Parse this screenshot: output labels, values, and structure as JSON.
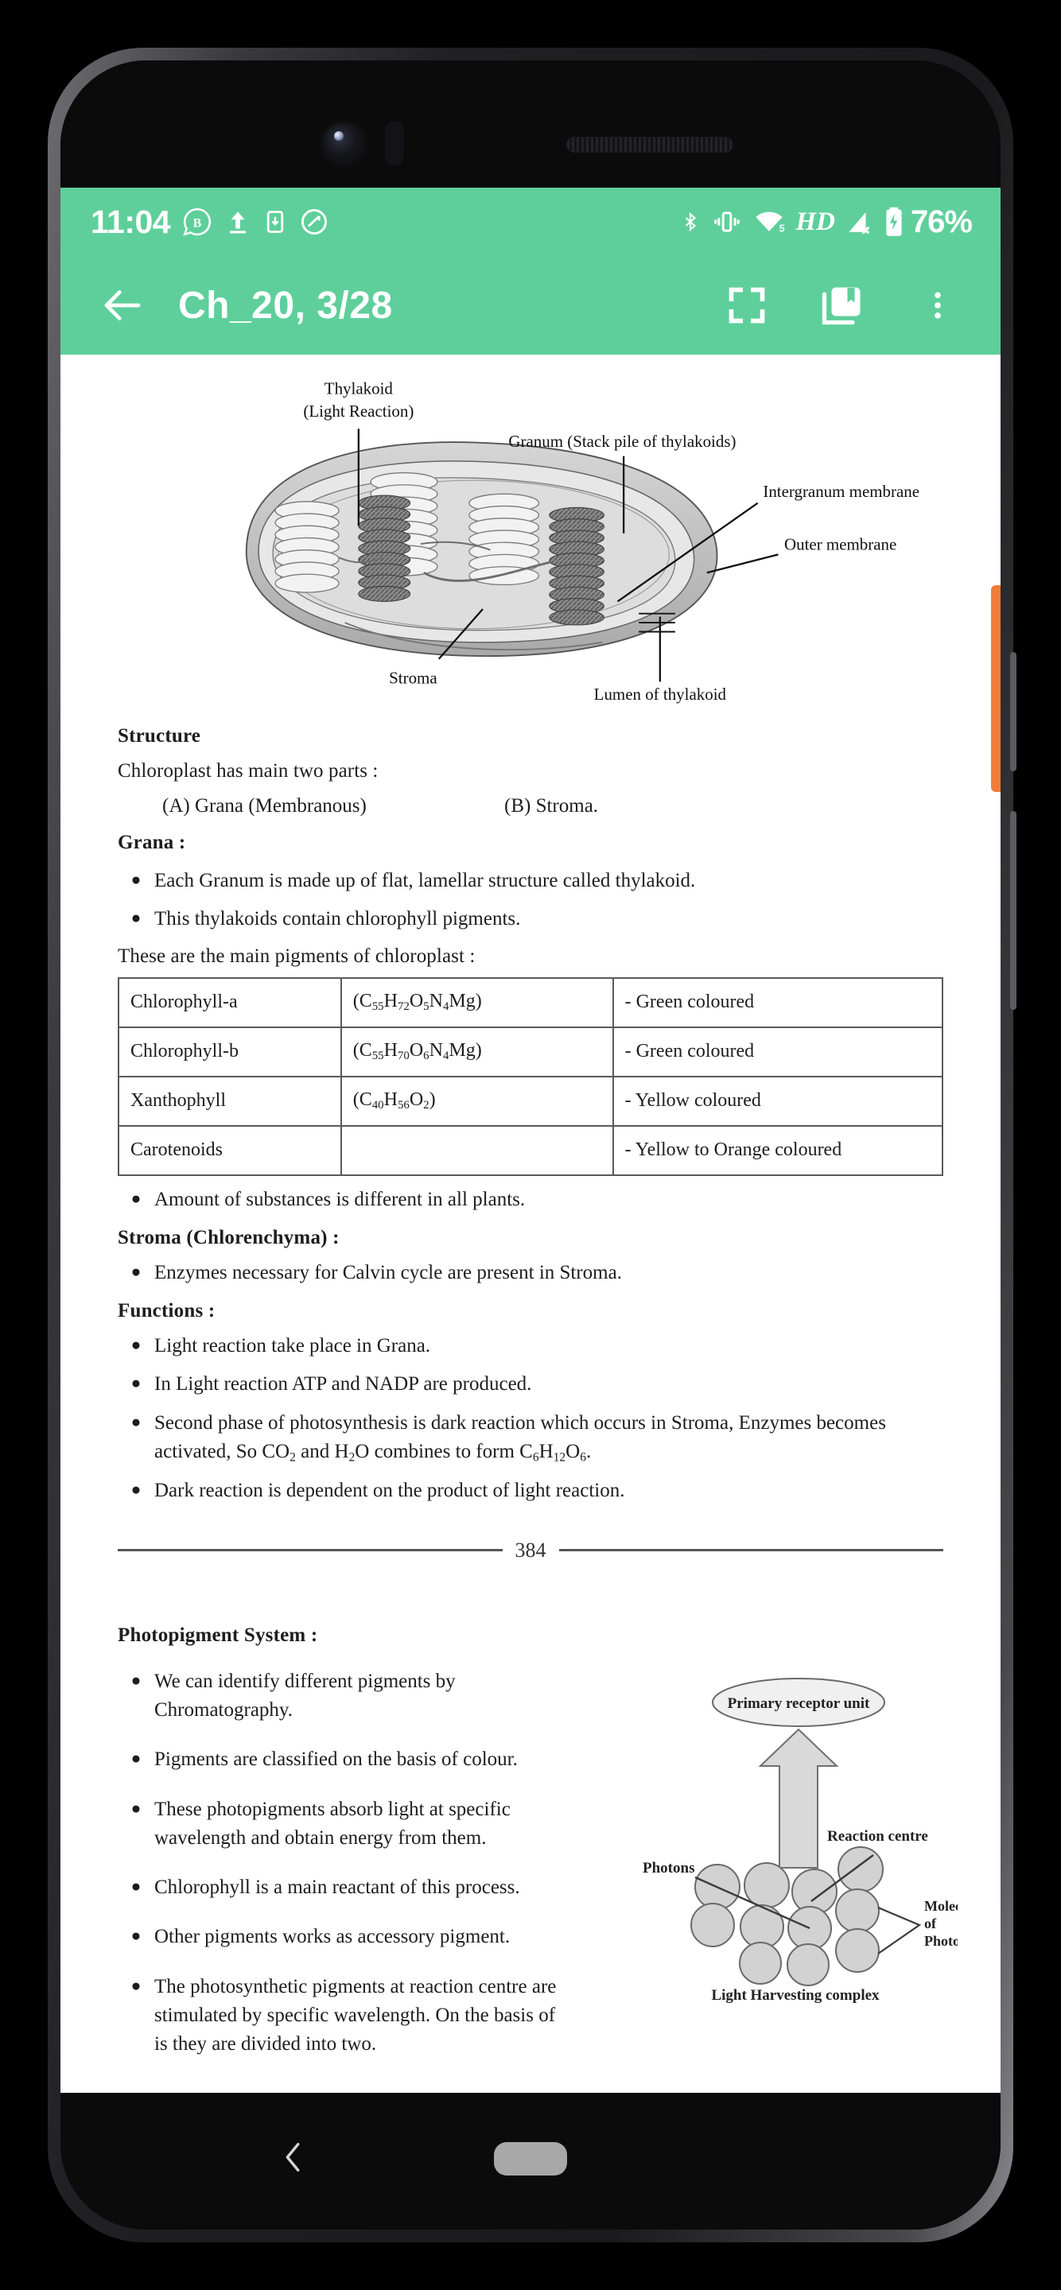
{
  "status_bar": {
    "clock": "11:04",
    "battery_percent": "76%",
    "hd_label": "HD",
    "left_icons": [
      "messaging-badge-icon",
      "upload-arrow-icon",
      "app-download-icon",
      "do-not-disturb-icon"
    ],
    "right_icons": [
      "bluetooth-icon",
      "vibrate-icon",
      "wifi-icon",
      "hd-voice-icon",
      "cellular-no-signal-icon",
      "battery-charging-icon"
    ],
    "background_color": "#5ecf9b"
  },
  "toolbar": {
    "title": "Ch_20, 3/28",
    "back_icon": "arrow-left-icon",
    "fullscreen_icon": "fullscreen-icon",
    "bookmark_icon": "library-bookmark-icon",
    "overflow_icon": "more-vertical-icon",
    "background_color": "#5ecf9b"
  },
  "figure_chloroplast": {
    "labels": [
      "Thylakoid",
      "(Light Reaction)",
      "Granum (Stack pile of thylakoids)",
      "Intergranum membrane",
      "Outer membrane",
      "Stroma",
      "Lumen of thylakoid"
    ]
  },
  "document": {
    "structure_heading": "Structure",
    "structure_intro": "Chloroplast has main two parts :",
    "parts": [
      "(A)  Grana (Membranous)",
      "(B)  Stroma."
    ],
    "grana_heading": "Grana :",
    "grana_bullets": [
      "Each Granum is made up of flat, lamellar structure called thylakoid.",
      "This thylakoids contain chlorophyll pigments."
    ],
    "table_intro": "These are the main pigments of chloroplast :",
    "pigments_table": {
      "rows": [
        {
          "name": "Chlorophyll-a",
          "formula_html": "(C<sub>55</sub>H<sub>72</sub>O<sub>5</sub>N<sub>4</sub>Mg)",
          "colour": "- Green coloured"
        },
        {
          "name": "Chlorophyll-b",
          "formula_html": "(C<sub>55</sub>H<sub>70</sub>O<sub>6</sub>N<sub>4</sub>Mg)",
          "colour": "- Green coloured"
        },
        {
          "name": "Xanthophyll",
          "formula_html": "(C<sub>40</sub>H<sub>56</sub>O<sub>2</sub>)",
          "colour": "- Yellow coloured"
        },
        {
          "name": "Carotenoids",
          "formula_html": "",
          "colour": "- Yellow to Orange coloured"
        }
      ]
    },
    "amount_bullet": "Amount of substances is different in all plants.",
    "stroma_heading": "Stroma (Chlorenchyma) :",
    "stroma_bullets": [
      "Enzymes necessary for Calvin cycle are present in Stroma."
    ],
    "functions_heading": "Functions :",
    "functions_bullets": [
      "Light reaction take place in Grana.",
      "In Light reaction ATP and NADP are produced.",
      "Dark reaction is dependent on the product of light reaction."
    ],
    "functions_bullet_rich_html": "Second phase of photosynthesis is dark reaction which occurs in Stroma, Enzymes becomes activated, So CO<sub>2</sub> and H<sub>2</sub>O combines to form C<sub>6</sub>H<sub>12</sub>O<sub>6</sub>.",
    "page_number": "384",
    "photopigment_heading": "Photopigment System :",
    "photopigment_bullets": [
      "We can identify different pigments by Chromatography.",
      "Pigments are classified on the basis of colour.",
      "These photopigments absorb light at specific wavelength and obtain energy from them.",
      "Chlorophyll is a main reactant of this process.",
      "Other pigments works as accessory pigment.",
      "The photosynthetic pigments at reaction centre are stimulated by specific wavelength. On the basis of is they are divided into two."
    ]
  },
  "figure_lhc": {
    "primary_receptor": "Primary receptor unit",
    "reaction_centre": "Reaction centre",
    "photons": "Photons",
    "molecules_line1": "Molecules",
    "molecules_line2": "of",
    "molecules_line3": "Photopigments",
    "caption": "Light Harvesting complex"
  },
  "nav_bar": {
    "back_icon": "chevron-left-icon",
    "home_icon": "home-pill-icon"
  },
  "scroll_indicator": {
    "color": "#f07d3a"
  }
}
